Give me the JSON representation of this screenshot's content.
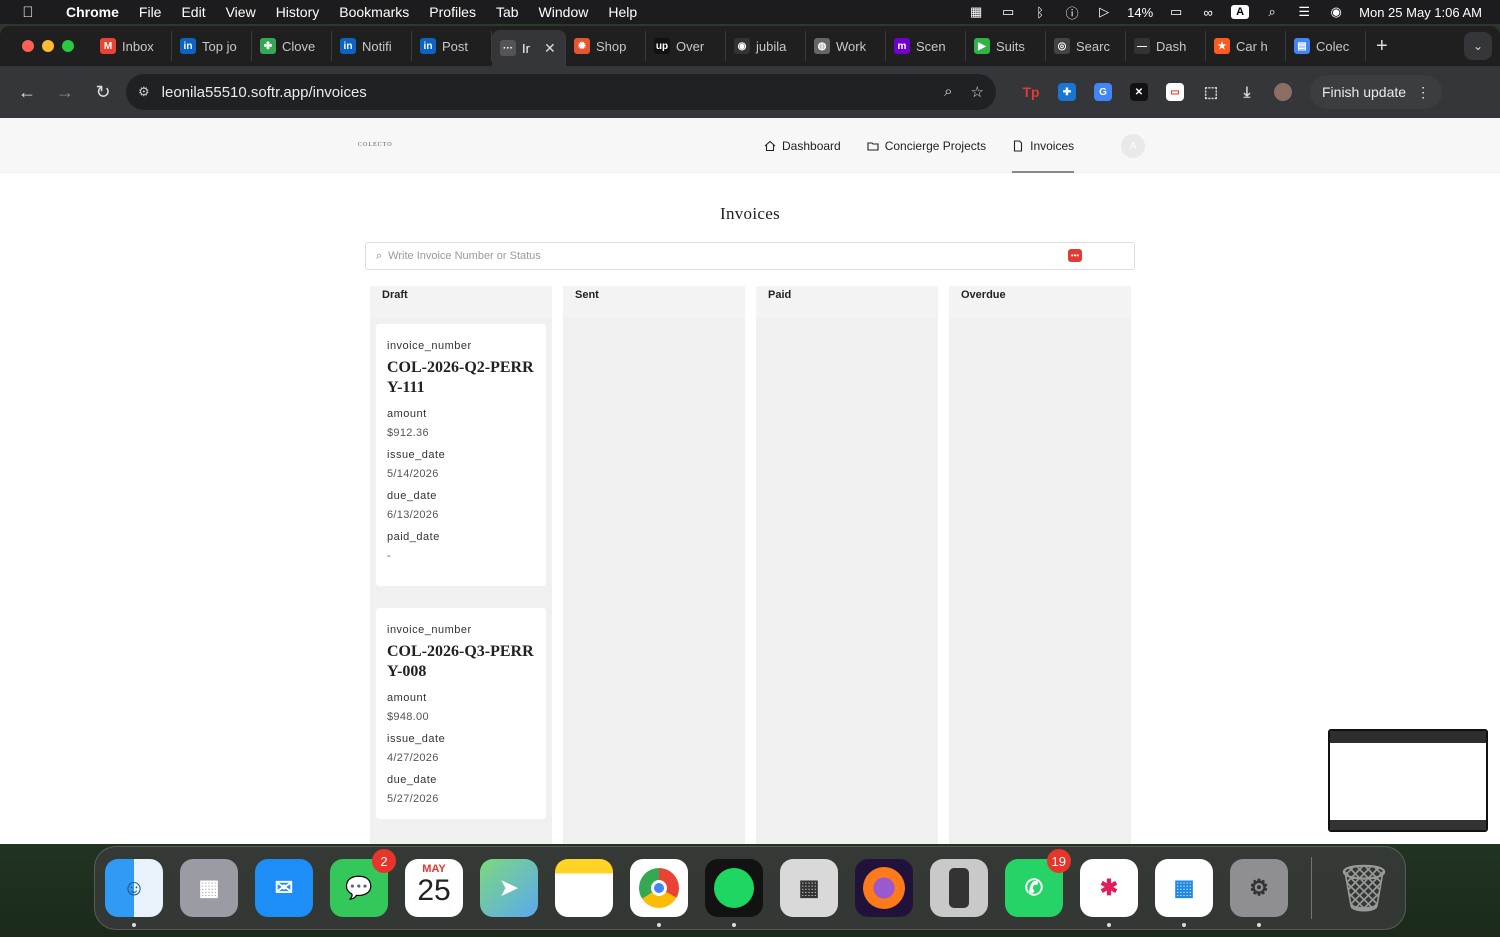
{
  "menubar": {
    "app": "Chrome",
    "items": [
      "File",
      "Edit",
      "View",
      "History",
      "Bookmarks",
      "Profiles",
      "Tab",
      "Window",
      "Help"
    ],
    "battery": "14%",
    "input_source": "A",
    "datetime": "Mon 25 May  1:06 AM"
  },
  "tabs": [
    {
      "label": "Inbox",
      "icon": "gmail-icon",
      "color": "#ea4335",
      "glyph": "M"
    },
    {
      "label": "Top jo",
      "icon": "linkedin-icon",
      "color": "#0a66c2",
      "glyph": "in"
    },
    {
      "label": "Clove",
      "icon": "clover-icon",
      "color": "#34a853",
      "glyph": "✤"
    },
    {
      "label": "Notifi",
      "icon": "linkedin-icon",
      "color": "#0a66c2",
      "glyph": "in"
    },
    {
      "label": "Post",
      "icon": "linkedin-icon",
      "color": "#0a66c2",
      "glyph": "in"
    },
    {
      "label": "Ir",
      "icon": "softr-icon",
      "color": "#555555",
      "glyph": "···",
      "active": true
    },
    {
      "label": "Shop",
      "icon": "spark-icon",
      "color": "#e4572e",
      "glyph": "✹"
    },
    {
      "label": "Over",
      "icon": "upwork-icon",
      "color": "#111111",
      "glyph": "up"
    },
    {
      "label": "jubila",
      "icon": "jubilant-icon",
      "color": "#333333",
      "glyph": "◉"
    },
    {
      "label": "Work",
      "icon": "globe-icon",
      "color": "#666666",
      "glyph": "◍"
    },
    {
      "label": "Scen",
      "icon": "make-icon",
      "color": "#6d00cc",
      "glyph": "m"
    },
    {
      "label": "Suits",
      "icon": "play-icon",
      "color": "#2fb344",
      "glyph": "▶"
    },
    {
      "label": "Searc",
      "icon": "search-app-icon",
      "color": "#444444",
      "glyph": "◎"
    },
    {
      "label": "Dash",
      "icon": "dash-icon",
      "color": "#333333",
      "glyph": "—"
    },
    {
      "label": "Car h",
      "icon": "car-icon",
      "color": "#ff5a1f",
      "glyph": "★"
    },
    {
      "label": "Colec",
      "icon": "docs-icon",
      "color": "#4285f4",
      "glyph": "▤"
    }
  ],
  "toolbar": {
    "url": "leonila55510.softr.app/invoices",
    "finish_update": "Finish update"
  },
  "site": {
    "logo": "COLECTO",
    "nav": [
      {
        "label": "Dashboard",
        "icon": "home-icon"
      },
      {
        "label": "Concierge Projects",
        "icon": "folder-icon"
      },
      {
        "label": "Invoices",
        "icon": "document-icon",
        "active": true
      }
    ],
    "avatar": "A"
  },
  "main": {
    "title": "Invoices",
    "search_placeholder": "Write Invoice Number or Status"
  },
  "board": {
    "columns": [
      "Draft",
      "Sent",
      "Paid",
      "Overdue"
    ],
    "labels": {
      "invoice_number": "invoice_number",
      "amount": "amount",
      "issue_date": "issue_date",
      "due_date": "due_date",
      "paid_date": "paid_date"
    },
    "cards": [
      {
        "invoice_number": "COL-2026-Q2-PERRY-111",
        "amount": "$912.36",
        "issue_date": "5/14/2026",
        "due_date": "6/13/2026",
        "paid_date": "-"
      },
      {
        "invoice_number": "COL-2026-Q3-PERRY-008",
        "amount": "$948.00",
        "issue_date": "4/27/2026",
        "due_date": "5/27/2026",
        "paid_date": ""
      }
    ]
  },
  "dock": {
    "messages_badge": "2",
    "calendar_month": "MAY",
    "calendar_day": "25",
    "whatsapp_badge": "19"
  }
}
